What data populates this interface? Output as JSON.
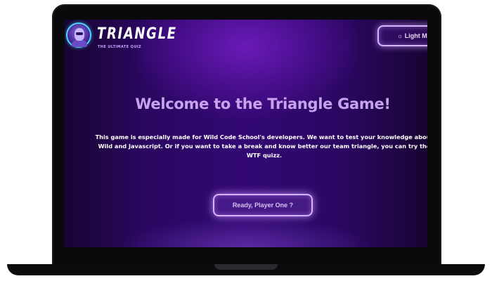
{
  "header": {
    "brand_title": "TRIANGLE",
    "brand_subtitle": "THE ULTIMATE QUIZ",
    "logo_icon": "robot-avatar-icon",
    "theme_button_label": "☼ Light Mo"
  },
  "hero": {
    "headline": "Welcome to the Triangle Game!",
    "intro": "This game is especially made for Wild Code School's developers. We want to test your knowledge about Wild and Javascript. Or if you want to take a break and know better our team triangle, you can try the WTF quizz.",
    "start_button_label": "Ready, Player One ?"
  },
  "colors": {
    "background": "#330874",
    "headline": "#c7a3ee",
    "neon_border": "#d8b6ff",
    "logo_ring": "#48d6ff"
  }
}
